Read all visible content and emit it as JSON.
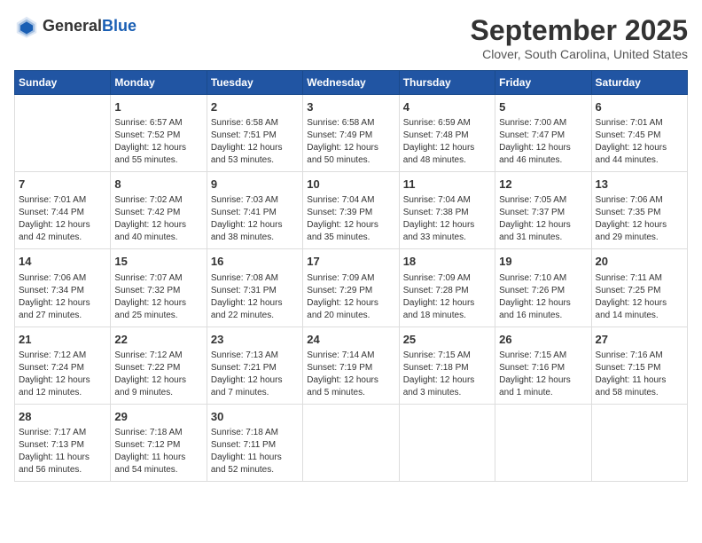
{
  "header": {
    "logo_general": "General",
    "logo_blue": "Blue",
    "title": "September 2025",
    "location": "Clover, South Carolina, United States"
  },
  "calendar": {
    "weekdays": [
      "Sunday",
      "Monday",
      "Tuesday",
      "Wednesday",
      "Thursday",
      "Friday",
      "Saturday"
    ],
    "weeks": [
      [
        {
          "day": "",
          "info": ""
        },
        {
          "day": "1",
          "info": "Sunrise: 6:57 AM\nSunset: 7:52 PM\nDaylight: 12 hours\nand 55 minutes."
        },
        {
          "day": "2",
          "info": "Sunrise: 6:58 AM\nSunset: 7:51 PM\nDaylight: 12 hours\nand 53 minutes."
        },
        {
          "day": "3",
          "info": "Sunrise: 6:58 AM\nSunset: 7:49 PM\nDaylight: 12 hours\nand 50 minutes."
        },
        {
          "day": "4",
          "info": "Sunrise: 6:59 AM\nSunset: 7:48 PM\nDaylight: 12 hours\nand 48 minutes."
        },
        {
          "day": "5",
          "info": "Sunrise: 7:00 AM\nSunset: 7:47 PM\nDaylight: 12 hours\nand 46 minutes."
        },
        {
          "day": "6",
          "info": "Sunrise: 7:01 AM\nSunset: 7:45 PM\nDaylight: 12 hours\nand 44 minutes."
        }
      ],
      [
        {
          "day": "7",
          "info": "Sunrise: 7:01 AM\nSunset: 7:44 PM\nDaylight: 12 hours\nand 42 minutes."
        },
        {
          "day": "8",
          "info": "Sunrise: 7:02 AM\nSunset: 7:42 PM\nDaylight: 12 hours\nand 40 minutes."
        },
        {
          "day": "9",
          "info": "Sunrise: 7:03 AM\nSunset: 7:41 PM\nDaylight: 12 hours\nand 38 minutes."
        },
        {
          "day": "10",
          "info": "Sunrise: 7:04 AM\nSunset: 7:39 PM\nDaylight: 12 hours\nand 35 minutes."
        },
        {
          "day": "11",
          "info": "Sunrise: 7:04 AM\nSunset: 7:38 PM\nDaylight: 12 hours\nand 33 minutes."
        },
        {
          "day": "12",
          "info": "Sunrise: 7:05 AM\nSunset: 7:37 PM\nDaylight: 12 hours\nand 31 minutes."
        },
        {
          "day": "13",
          "info": "Sunrise: 7:06 AM\nSunset: 7:35 PM\nDaylight: 12 hours\nand 29 minutes."
        }
      ],
      [
        {
          "day": "14",
          "info": "Sunrise: 7:06 AM\nSunset: 7:34 PM\nDaylight: 12 hours\nand 27 minutes."
        },
        {
          "day": "15",
          "info": "Sunrise: 7:07 AM\nSunset: 7:32 PM\nDaylight: 12 hours\nand 25 minutes."
        },
        {
          "day": "16",
          "info": "Sunrise: 7:08 AM\nSunset: 7:31 PM\nDaylight: 12 hours\nand 22 minutes."
        },
        {
          "day": "17",
          "info": "Sunrise: 7:09 AM\nSunset: 7:29 PM\nDaylight: 12 hours\nand 20 minutes."
        },
        {
          "day": "18",
          "info": "Sunrise: 7:09 AM\nSunset: 7:28 PM\nDaylight: 12 hours\nand 18 minutes."
        },
        {
          "day": "19",
          "info": "Sunrise: 7:10 AM\nSunset: 7:26 PM\nDaylight: 12 hours\nand 16 minutes."
        },
        {
          "day": "20",
          "info": "Sunrise: 7:11 AM\nSunset: 7:25 PM\nDaylight: 12 hours\nand 14 minutes."
        }
      ],
      [
        {
          "day": "21",
          "info": "Sunrise: 7:12 AM\nSunset: 7:24 PM\nDaylight: 12 hours\nand 12 minutes."
        },
        {
          "day": "22",
          "info": "Sunrise: 7:12 AM\nSunset: 7:22 PM\nDaylight: 12 hours\nand 9 minutes."
        },
        {
          "day": "23",
          "info": "Sunrise: 7:13 AM\nSunset: 7:21 PM\nDaylight: 12 hours\nand 7 minutes."
        },
        {
          "day": "24",
          "info": "Sunrise: 7:14 AM\nSunset: 7:19 PM\nDaylight: 12 hours\nand 5 minutes."
        },
        {
          "day": "25",
          "info": "Sunrise: 7:15 AM\nSunset: 7:18 PM\nDaylight: 12 hours\nand 3 minutes."
        },
        {
          "day": "26",
          "info": "Sunrise: 7:15 AM\nSunset: 7:16 PM\nDaylight: 12 hours\nand 1 minute."
        },
        {
          "day": "27",
          "info": "Sunrise: 7:16 AM\nSunset: 7:15 PM\nDaylight: 11 hours\nand 58 minutes."
        }
      ],
      [
        {
          "day": "28",
          "info": "Sunrise: 7:17 AM\nSunset: 7:13 PM\nDaylight: 11 hours\nand 56 minutes."
        },
        {
          "day": "29",
          "info": "Sunrise: 7:18 AM\nSunset: 7:12 PM\nDaylight: 11 hours\nand 54 minutes."
        },
        {
          "day": "30",
          "info": "Sunrise: 7:18 AM\nSunset: 7:11 PM\nDaylight: 11 hours\nand 52 minutes."
        },
        {
          "day": "",
          "info": ""
        },
        {
          "day": "",
          "info": ""
        },
        {
          "day": "",
          "info": ""
        },
        {
          "day": "",
          "info": ""
        }
      ]
    ]
  }
}
